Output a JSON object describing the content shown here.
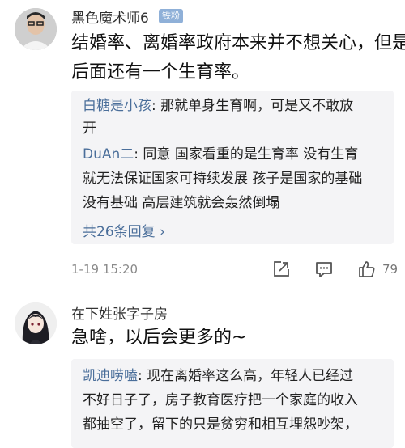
{
  "comments": [
    {
      "username": "黑色魔术师6",
      "badge": "铁粉",
      "lines": [
        "结婚率、离婚率政府本来并不想关心，但是",
        "后面还有一个生育率。"
      ],
      "replies": [
        {
          "name": "白糖是小孩",
          "sep": ": ",
          "lines": [
            "那就单身生育啊，可是又不敢放",
            "开"
          ]
        },
        {
          "name": "DuAn二",
          "sep": ": ",
          "lines": [
            "同意 国家看重的是生育率 没有生育",
            "就无法保证国家可持续发展 孩子是国家的基础",
            "没有基础 高层建筑就会轰然倒塌"
          ]
        }
      ],
      "more_replies": "共26条回复 ›",
      "time": "1-19 15:20",
      "likes": "79"
    },
    {
      "username": "在下姓张字子房",
      "lines": [
        "急啥，以后会更多的~"
      ],
      "replies": [
        {
          "name": "凯迪唠嗑",
          "sep": ": ",
          "lines": [
            "现在离婚率这么高，年轻人已经过",
            "不好日子了，房子教育医疗把一个家庭的收入",
            "都抽空了，留下的只是贫穷和相互埋怨吵架，"
          ]
        }
      ]
    }
  ],
  "icons": [
    "share-icon",
    "comment-icon",
    "like-icon"
  ]
}
